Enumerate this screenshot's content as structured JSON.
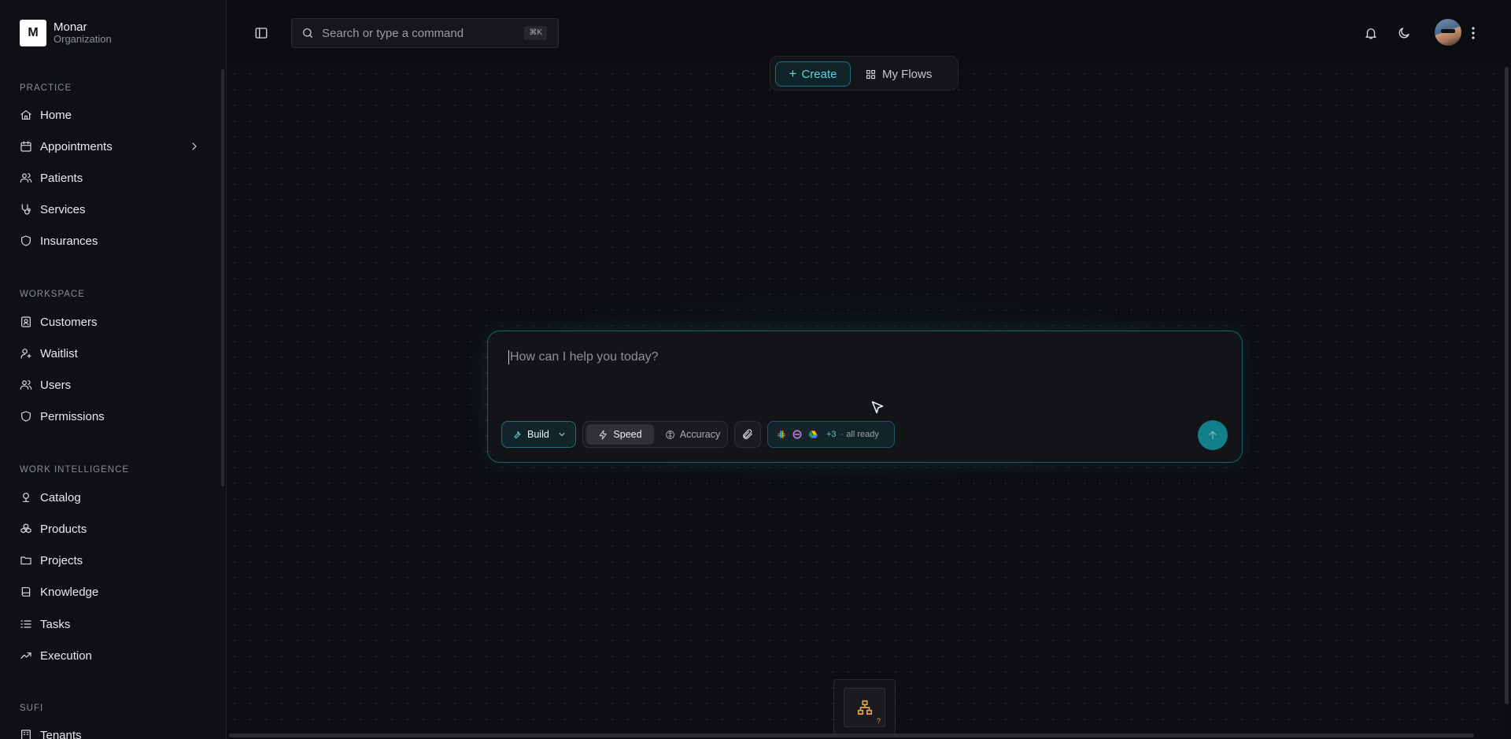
{
  "org": {
    "logo_letter": "M",
    "name": "Monar",
    "subtitle": "Organization"
  },
  "sidebar": {
    "sections": [
      {
        "label": "PRACTICE",
        "items": [
          {
            "label": "Home",
            "icon": "home-icon"
          },
          {
            "label": "Appointments",
            "icon": "calendar-icon",
            "has_submenu": true
          },
          {
            "label": "Patients",
            "icon": "users-icon"
          },
          {
            "label": "Services",
            "icon": "stethoscope-icon"
          },
          {
            "label": "Insurances",
            "icon": "shield-icon"
          }
        ]
      },
      {
        "label": "WORKSPACE",
        "items": [
          {
            "label": "Customers",
            "icon": "contacts-icon"
          },
          {
            "label": "Waitlist",
            "icon": "user-plus-icon"
          },
          {
            "label": "Users",
            "icon": "users-icon"
          },
          {
            "label": "Permissions",
            "icon": "shield-icon"
          }
        ]
      },
      {
        "label": "WORK INTELLIGENCE",
        "items": [
          {
            "label": "Catalog",
            "icon": "catalog-icon"
          },
          {
            "label": "Products",
            "icon": "boxes-icon"
          },
          {
            "label": "Projects",
            "icon": "folder-icon"
          },
          {
            "label": "Knowledge",
            "icon": "book-icon"
          },
          {
            "label": "Tasks",
            "icon": "list-icon"
          },
          {
            "label": "Execution",
            "icon": "activity-icon"
          }
        ]
      },
      {
        "label": "SUFI",
        "items": [
          {
            "label": "Tenants",
            "icon": "building-icon"
          }
        ]
      }
    ]
  },
  "topbar": {
    "search_placeholder": "Search or type a command",
    "search_shortcut": "⌘K"
  },
  "main": {
    "create_label": "Create",
    "my_flows_label": "My Flows",
    "prompt_placeholder": "How can I help you today?",
    "build_label": "Build",
    "speed_label": "Speed",
    "accuracy_label": "Accuracy",
    "apps_more": "+3",
    "apps_status": "· all ready"
  },
  "colors": {
    "accent": "#127f8a",
    "accent_text": "#5fd4e0",
    "background": "#0c0d10"
  }
}
